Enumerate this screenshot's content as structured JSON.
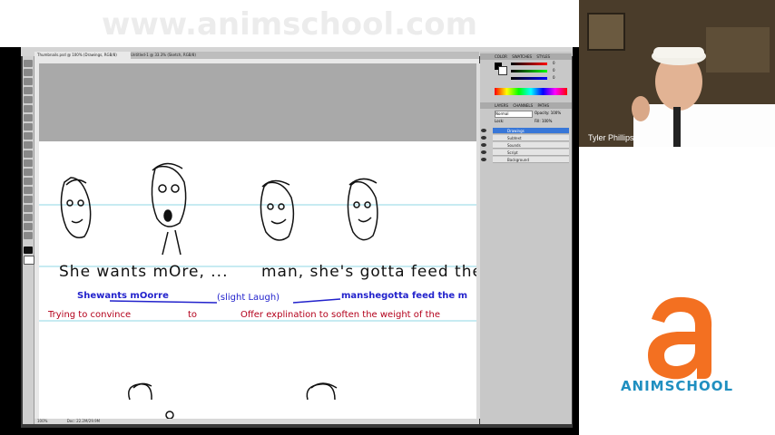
{
  "watermark": {
    "text": "www.animschool.com"
  },
  "webcam": {
    "presenter_name": "Tyler Phillips"
  },
  "logo": {
    "letter": "a",
    "brand_text": "ANIMSCHOOL",
    "brand_color": "#1f8fc0",
    "letter_color": "#f37021"
  },
  "photoshop": {
    "tabs": [
      {
        "label": "Thumbnails.psd @ 100% (Drawings, RGB/8)"
      },
      {
        "label": "Untitled-1 @ 33.3% (Sketch, RGB/8)"
      }
    ],
    "status": {
      "zoom": "100%",
      "doc": "Doc: 22.2M/29.9M"
    },
    "panel_tabs": [
      "COLOR",
      "SWATCHES",
      "STYLES"
    ],
    "color_values": [
      "0",
      "0",
      "0"
    ],
    "layers_tabs": [
      "LAYERS",
      "CHANNELS",
      "PATHS"
    ],
    "blend_mode": "Normal",
    "opacity": "Opacity: 100%",
    "fill": "Fill: 100%",
    "lock": "Lock:",
    "layers": [
      {
        "name": "Drawings",
        "selected": true
      },
      {
        "name": "Subtext",
        "selected": false
      },
      {
        "name": "Sounds",
        "selected": false
      },
      {
        "name": "Script",
        "selected": false
      },
      {
        "name": "Background",
        "selected": false
      }
    ],
    "canvas": {
      "dialogue_line1": "She wants mOre, ...",
      "dialogue_line2": "man, she's gotta feed the",
      "sound_line1": "Shewants mOorre",
      "sound_line2": "(slight Laugh)",
      "sound_line3": "manshegotta feed the m",
      "subtext1": "Trying to convince",
      "subtext2": "to",
      "subtext3": "Offer explination to soften the weight of the"
    }
  }
}
